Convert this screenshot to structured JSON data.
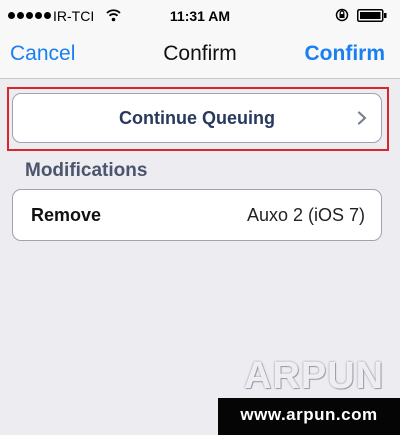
{
  "status_bar": {
    "carrier": "IR-TCI",
    "time": "11:31 AM"
  },
  "nav": {
    "cancel_label": "Cancel",
    "title": "Confirm",
    "confirm_label": "Confirm"
  },
  "queue": {
    "label": "Continue Queuing"
  },
  "modifications": {
    "header": "Modifications",
    "items": [
      {
        "action": "Remove",
        "package": "Auxo 2 (iOS 7)"
      }
    ]
  },
  "watermark": {
    "logo": "ARPUN",
    "url": "www.arpun.com"
  },
  "colors": {
    "accent": "#1a7ff0",
    "highlight": "#d8262c"
  }
}
